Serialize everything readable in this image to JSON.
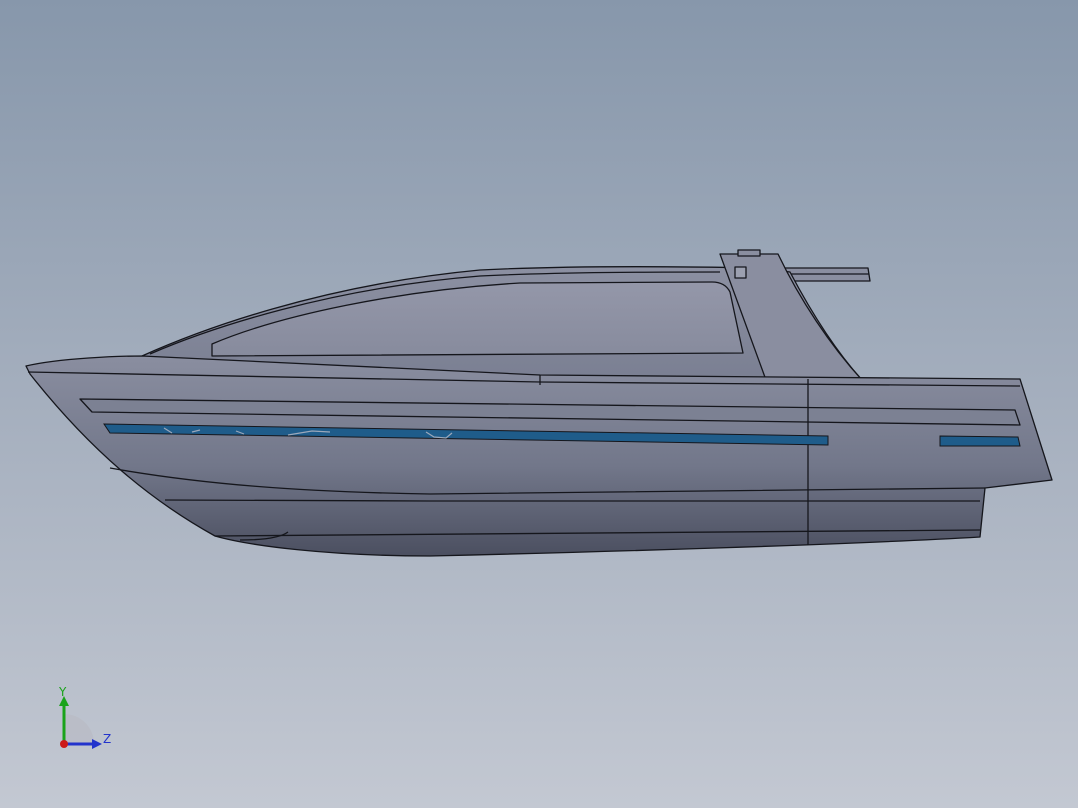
{
  "viewport": {
    "background_top": "#8797ab",
    "background_bottom": "#c3c8d2"
  },
  "model": {
    "hull_color": "#7d8293",
    "stripe_color": "#1f5c8a",
    "edge_color": "#15161c"
  },
  "triad": {
    "y_label": "Y",
    "z_label": "Z",
    "y_color": "#1aa31a",
    "z_color": "#2233cc",
    "x_color": "#cc1a1a"
  }
}
